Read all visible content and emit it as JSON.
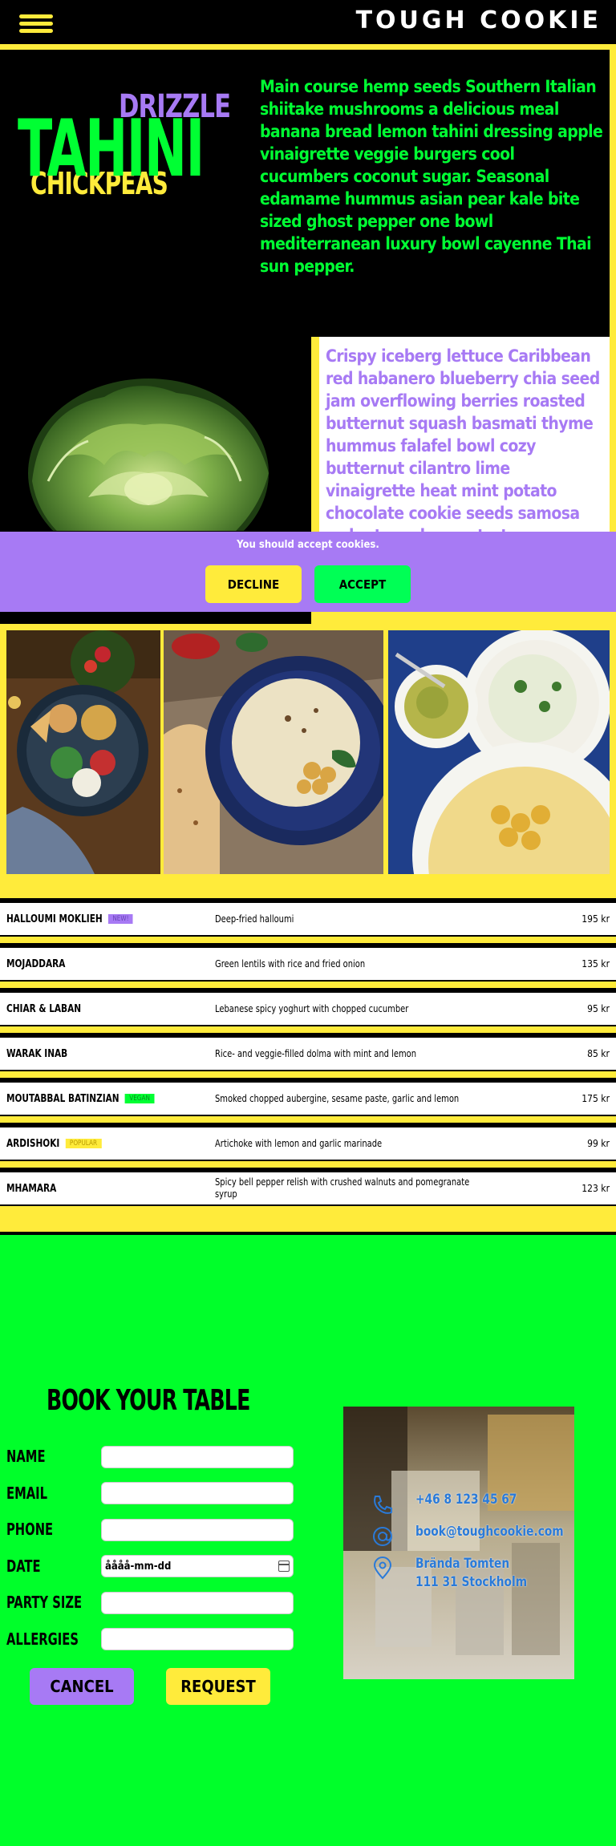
{
  "header": {
    "brand": "TOUGH COOKIE",
    "menu_icon": "hamburger-menu-icon"
  },
  "hero": {
    "drizzle": "DRIZZLE",
    "tahini": "TAHINI",
    "chickpeas": "CHICKPEAS",
    "text": "Main course hemp seeds Southern Italian shiitake mushrooms a delicious meal banana bread lemon tahini dressing apple vinaigrette veggie burgers cool cucumbers coconut sugar. Seasonal edamame hummus asian pear kale bite sized ghost pepper one bowl mediterranean luxury bowl cayenne Thai sun pepper.",
    "card_text": "Crispy iceberg lettuce Caribbean red habanero blueberry chia seed jam overflowing berries roasted butternut squash basmati thyme hummus falafel bowl cozy butternut cilantro lime vinaigrette heat mint potato chocolate cookie seeds samosa walnut mushroom tart."
  },
  "cookie_banner": {
    "text": "You should accept cookies.",
    "decline": "DECLINE",
    "accept": "ACCEPT"
  },
  "menu": [
    {
      "name": "HALLOUMI MOKLIEH",
      "badge": "NEW!",
      "badge_color": "#a77af4",
      "description": "Deep-fried halloumi",
      "price": "195 kr"
    },
    {
      "name": "MOJADDARA",
      "badge": "",
      "badge_color": "",
      "description": "Green lentils with rice and fried onion",
      "price": "135 kr"
    },
    {
      "name": "CHIAR & LABAN",
      "badge": "",
      "badge_color": "",
      "description": "Lebanese spicy yoghurt with chopped cucumber",
      "price": "95 kr"
    },
    {
      "name": "WARAK INAB",
      "badge": "",
      "badge_color": "",
      "description": "Rice- and veggie-filled dolma with mint and lemon",
      "price": "85 kr"
    },
    {
      "name": "MOUTABBAL BATINZIAN",
      "badge": "VEGAN",
      "badge_color": "#00ff33",
      "description": "Smoked chopped aubergine, sesame paste, garlic and lemon",
      "price": "175 kr"
    },
    {
      "name": "ARDISHOKI",
      "badge": "POPULAR",
      "badge_color": "#ffeb3b",
      "description": "Artichoke with lemon and garlic marinade",
      "price": "99 kr"
    },
    {
      "name": "MHAMARA",
      "badge": "",
      "badge_color": "",
      "description": "Spicy bell pepper relish with crushed walnuts and pomegranate syrup",
      "price": "123 kr"
    }
  ],
  "booking": {
    "title": "BOOK YOUR TABLE",
    "fields": [
      {
        "label": "NAME",
        "value": ""
      },
      {
        "label": "EMAIL",
        "value": ""
      },
      {
        "label": "PHONE",
        "value": ""
      },
      {
        "label": "DATE",
        "value": "åååå-mm-dd"
      },
      {
        "label": "PARTY SIZE",
        "value": ""
      },
      {
        "label": "ALLERGIES",
        "value": ""
      }
    ],
    "cancel": "CANCEL",
    "request": "REQUEST",
    "contact": {
      "phone": "+46 8 123 45 67",
      "email": "book@toughcookie.com",
      "address_line1": "Brända Tomten",
      "address_line2": "111 31 Stockholm"
    }
  },
  "colors": {
    "yellow": "#ffeb3b",
    "green": "#00ff33",
    "purple": "#a77af4",
    "black": "#000000"
  }
}
